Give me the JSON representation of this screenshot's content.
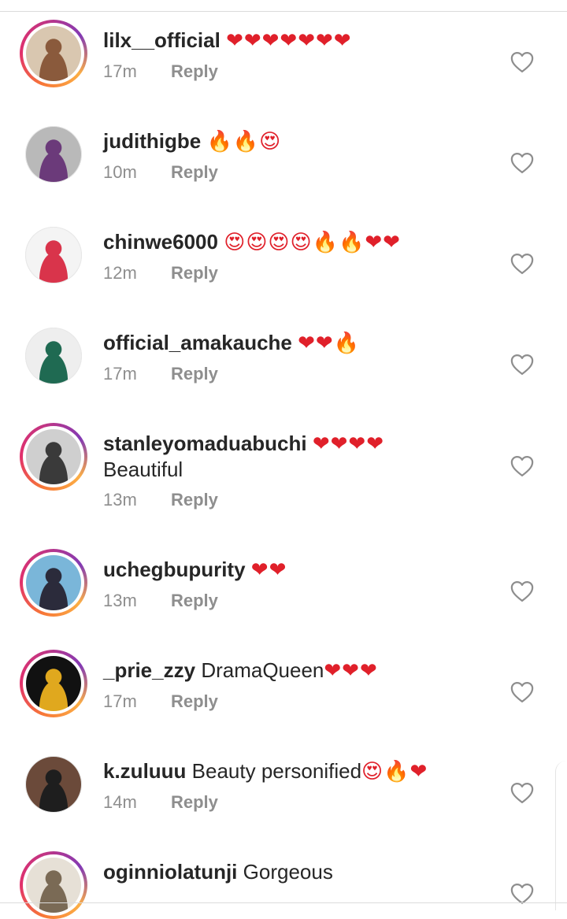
{
  "comments": [
    {
      "username": "lilx__official",
      "text": "",
      "emojis": "❤❤❤❤❤❤❤",
      "time": "17m",
      "reply_label": "Reply",
      "story_ring": true,
      "avatar_colors": [
        "#d9c7b0",
        "#8a5a3c"
      ]
    },
    {
      "username": "judithigbe",
      "text": "",
      "emojis": "🔥🔥😍",
      "time": "10m",
      "reply_label": "Reply",
      "story_ring": false,
      "avatar_colors": [
        "#b9b9b9",
        "#6b3a7a"
      ]
    },
    {
      "username": "chinwe6000",
      "text": "",
      "emojis": "😍😍😍😍🔥🔥❤❤",
      "time": "12m",
      "reply_label": "Reply",
      "story_ring": false,
      "avatar_colors": [
        "#f4f4f4",
        "#d9344b"
      ]
    },
    {
      "username": "official_amakauche",
      "text": "",
      "emojis": "❤❤🔥",
      "time": "17m",
      "reply_label": "Reply",
      "story_ring": false,
      "avatar_colors": [
        "#eeeeee",
        "#1f6a52"
      ]
    },
    {
      "username": "stanleyomaduabuchi",
      "text": "",
      "emojis": "❤❤❤❤",
      "second_line": "Beautiful",
      "time": "13m",
      "reply_label": "Reply",
      "story_ring": true,
      "avatar_colors": [
        "#cfcfcf",
        "#3a3a3a"
      ]
    },
    {
      "username": "uchegbupurity",
      "text": "",
      "emojis": "❤❤",
      "time": "13m",
      "reply_label": "Reply",
      "story_ring": true,
      "avatar_colors": [
        "#7ab6d9",
        "#2b2b3b"
      ]
    },
    {
      "username": "_prie_zzy",
      "text": "DramaQueen",
      "emojis": "❤❤❤",
      "time": "17m",
      "reply_label": "Reply",
      "story_ring": true,
      "avatar_colors": [
        "#111111",
        "#e0a81e"
      ]
    },
    {
      "username": "k.zuluuu",
      "text": "Beauty personified",
      "emojis": "😍🔥❤",
      "time": "14m",
      "reply_label": "Reply",
      "story_ring": false,
      "avatar_colors": [
        "#6b4a3a",
        "#1e1e1e"
      ]
    },
    {
      "username": "oginniolatunji",
      "text": "Gorgeous",
      "emojis": "",
      "time": "",
      "reply_label": "",
      "story_ring": true,
      "avatar_colors": [
        "#e6e0d6",
        "#7a6a55"
      ]
    }
  ],
  "colors": {
    "username": "#262626",
    "meta": "#8e8e8e",
    "heart_outline": "#8e8e8e",
    "emoji_red": "#e0202a",
    "divider": "#dbdbdb"
  },
  "icons": {
    "like": "heart-outline-icon"
  }
}
